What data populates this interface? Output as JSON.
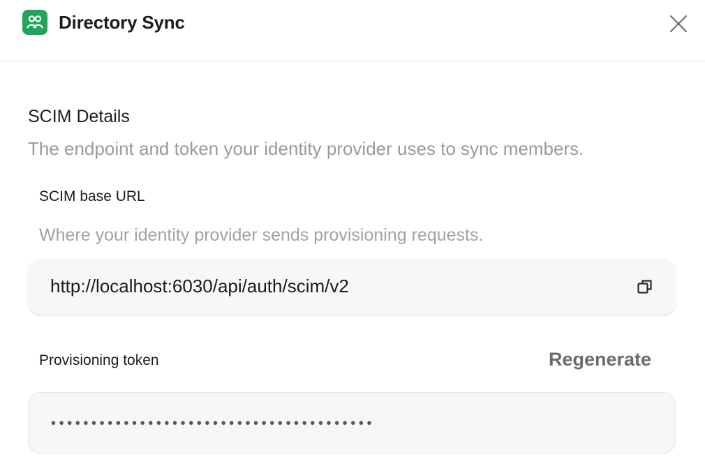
{
  "header": {
    "title": "Directory Sync",
    "app_icon": "users-group-icon",
    "close_icon": "close-icon"
  },
  "scim": {
    "title": "SCIM Details",
    "description": "The endpoint and token your identity provider uses to sync members."
  },
  "base_url": {
    "label": "SCIM base URL",
    "help": "Where your identity provider sends provisioning requests.",
    "value": "http://localhost:6030/api/auth/scim/v2",
    "copy_icon": "copy-icon"
  },
  "token": {
    "label": "Provisioning token",
    "regenerate_label": "Regenerate",
    "masked_value": "••••••••••••••••••••••••••••••••••••••••"
  },
  "colors": {
    "accent": "#22a45d",
    "muted_text": "#9a9a9a",
    "field_bg": "#f7f7f7"
  }
}
